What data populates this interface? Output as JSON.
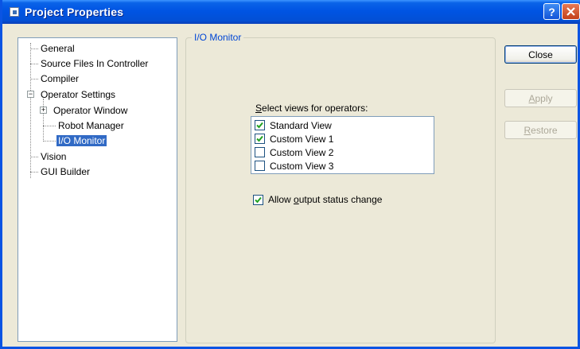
{
  "window": {
    "title": "Project Properties"
  },
  "tree": {
    "items": [
      {
        "label": "General"
      },
      {
        "label": "Source Files In Controller"
      },
      {
        "label": "Compiler"
      },
      {
        "label": "Operator Settings"
      },
      {
        "label": "Operator Window"
      },
      {
        "label": "Robot Manager"
      },
      {
        "label": "I/O Monitor",
        "selected": true
      },
      {
        "label": "Vision"
      },
      {
        "label": "GUI Builder"
      }
    ]
  },
  "panel": {
    "group_title": "I/O Monitor",
    "views_label_pre": "",
    "views_label_accel": "S",
    "views_label_post": "elect views for operators:",
    "views": [
      {
        "label": "Standard View",
        "checked": true
      },
      {
        "label": "Custom View 1",
        "checked": true
      },
      {
        "label": "Custom View 2",
        "checked": false
      },
      {
        "label": "Custom View 3",
        "checked": false
      }
    ],
    "allow_pre": "Allow ",
    "allow_accel": "o",
    "allow_post": "utput status change",
    "allow_checked": true
  },
  "buttons": {
    "close": "Close",
    "apply_accel": "A",
    "apply_rest": "pply",
    "restore_accel": "R",
    "restore_rest": "estore"
  },
  "colors": {
    "selection": "#316ac5",
    "titlebar": "#0054e3",
    "group_title": "#0046d5"
  }
}
